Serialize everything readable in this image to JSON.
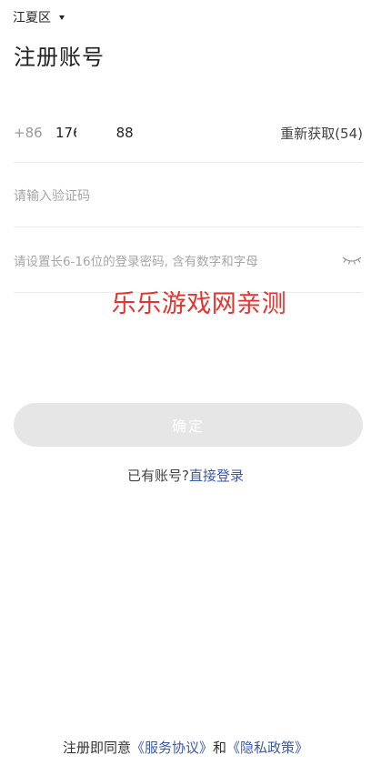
{
  "header": {
    "region": "江夏区",
    "title": "注册账号"
  },
  "form": {
    "phone": {
      "prefix": "+86",
      "number_start": "176",
      "number_end": "88"
    },
    "resend_label": "重新获取(54)",
    "code_placeholder": "请输入验证码",
    "password_placeholder": "请设置长6-16位的登录密码, 含有数字和字母",
    "confirm_label": "确定"
  },
  "watermark": "乐乐游戏网亲测",
  "login": {
    "prompt": "已有账号?",
    "link": "直接登录"
  },
  "agreement": {
    "prefix": "注册即同意",
    "service_link": "《服务协议》",
    "and": "和",
    "privacy_link": "《隐私政策》"
  },
  "icons": {
    "region_caret": "caret-down-icon",
    "password_toggle": "eye-closed-icon"
  },
  "colors": {
    "link": "#3d5aa6",
    "watermark": "#e8322d",
    "button_disabled": "#e6e6e6"
  }
}
